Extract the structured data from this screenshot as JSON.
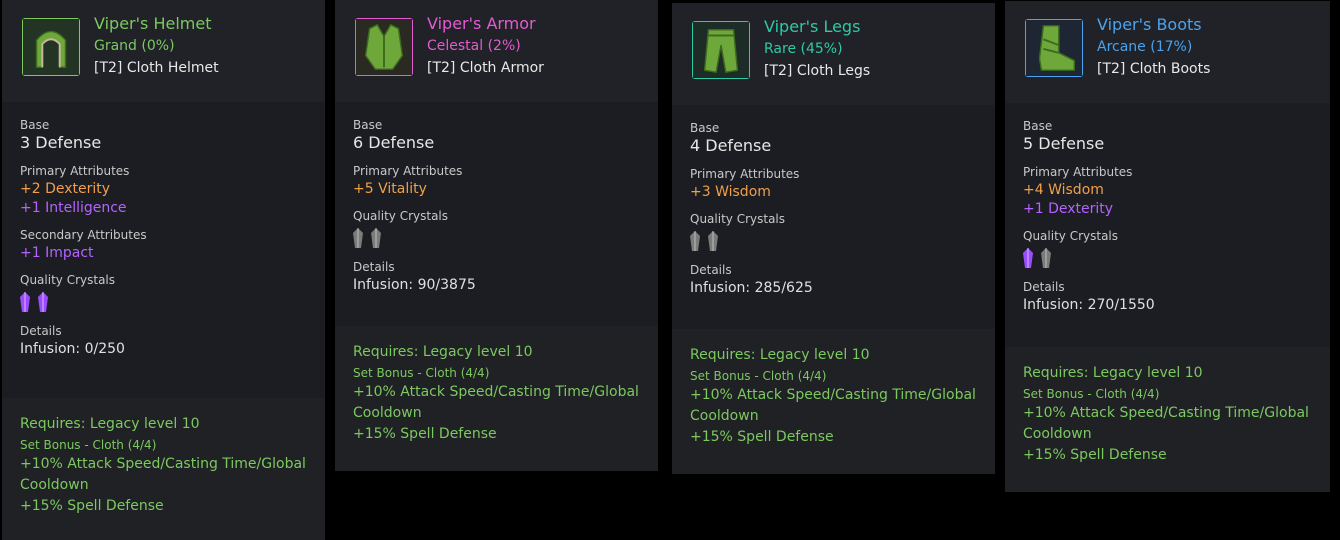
{
  "cards": [
    {
      "name": "Viper's Helmet",
      "rarity": "Grand (0%)",
      "rarity_color": "#7cc95f",
      "border_color": "#7cc95f",
      "item_type": "[T2] Cloth Helmet",
      "icon": "helmet-icon",
      "base_label": "Base",
      "base_value": "3 Defense",
      "primary_label": "Primary Attributes",
      "primary": [
        {
          "text": "+2 Dexterity",
          "color": "#f0a04a"
        },
        {
          "text": "+1 Intelligence",
          "color": "#b463ff"
        }
      ],
      "secondary_label": "Secondary Attributes",
      "secondary": [
        {
          "text": "+1 Impact",
          "color": "#b463ff"
        }
      ],
      "crystals_label": "Quality Crystals",
      "crystals": [
        "purple",
        "purple"
      ],
      "details_label": "Details",
      "infusion": "Infusion: 0/250",
      "requires": "Requires: Legacy level 10",
      "set_bonus": "Set Bonus - Cloth (4/4)",
      "bonus_1": "+10% Attack Speed/Casting Time/Global Cooldown",
      "bonus_2": "+15% Spell Defense"
    },
    {
      "name": "Viper's Armor",
      "rarity": "Celestal (2%)",
      "rarity_color": "#e35bd2",
      "border_color": "#e35bd2",
      "item_type": "[T2] Cloth Armor",
      "icon": "armor-icon",
      "base_label": "Base",
      "base_value": "6 Defense",
      "primary_label": "Primary Attributes",
      "primary": [
        {
          "text": "+5 Vitality",
          "color": "#f0a04a"
        }
      ],
      "crystals_label": "Quality Crystals",
      "crystals": [
        "gray",
        "gray"
      ],
      "details_label": "Details",
      "infusion": "Infusion: 90/3875",
      "requires": "Requires: Legacy level 10",
      "set_bonus": "Set Bonus - Cloth (4/4)",
      "bonus_1": "+10% Attack Speed/Casting Time/Global Cooldown",
      "bonus_2": "+15% Spell Defense"
    },
    {
      "name": "Viper's Legs",
      "rarity": "Rare (45%)",
      "rarity_color": "#2fc9a4",
      "border_color": "#2fc9a4",
      "item_type": "[T2] Cloth Legs",
      "icon": "legs-icon",
      "base_label": "Base",
      "base_value": "4 Defense",
      "primary_label": "Primary Attributes",
      "primary": [
        {
          "text": "+3 Wisdom",
          "color": "#f0a04a"
        }
      ],
      "crystals_label": "Quality Crystals",
      "crystals": [
        "gray",
        "gray"
      ],
      "details_label": "Details",
      "infusion": "Infusion: 285/625",
      "requires": "Requires: Legacy level 10",
      "set_bonus": "Set Bonus - Cloth (4/4)",
      "bonus_1": "+10% Attack Speed/Casting Time/Global Cooldown",
      "bonus_2": "+15% Spell Defense"
    },
    {
      "name": "Viper's Boots",
      "rarity": "Arcane (17%)",
      "rarity_color": "#4aa3f0",
      "border_color": "#4aa3f0",
      "item_type": "[T2] Cloth Boots",
      "icon": "boots-icon",
      "base_label": "Base",
      "base_value": "5 Defense",
      "primary_label": "Primary Attributes",
      "primary": [
        {
          "text": "+4 Wisdom",
          "color": "#f0a04a"
        },
        {
          "text": "+1 Dexterity",
          "color": "#b463ff"
        }
      ],
      "crystals_label": "Quality Crystals",
      "crystals": [
        "purple",
        "gray"
      ],
      "details_label": "Details",
      "infusion": "Infusion: 270/1550",
      "requires": "Requires: Legacy level 10",
      "set_bonus": "Set Bonus - Cloth (4/4)",
      "bonus_1": "+10% Attack Speed/Casting Time/Global Cooldown",
      "bonus_2": "+15% Spell Defense"
    }
  ]
}
